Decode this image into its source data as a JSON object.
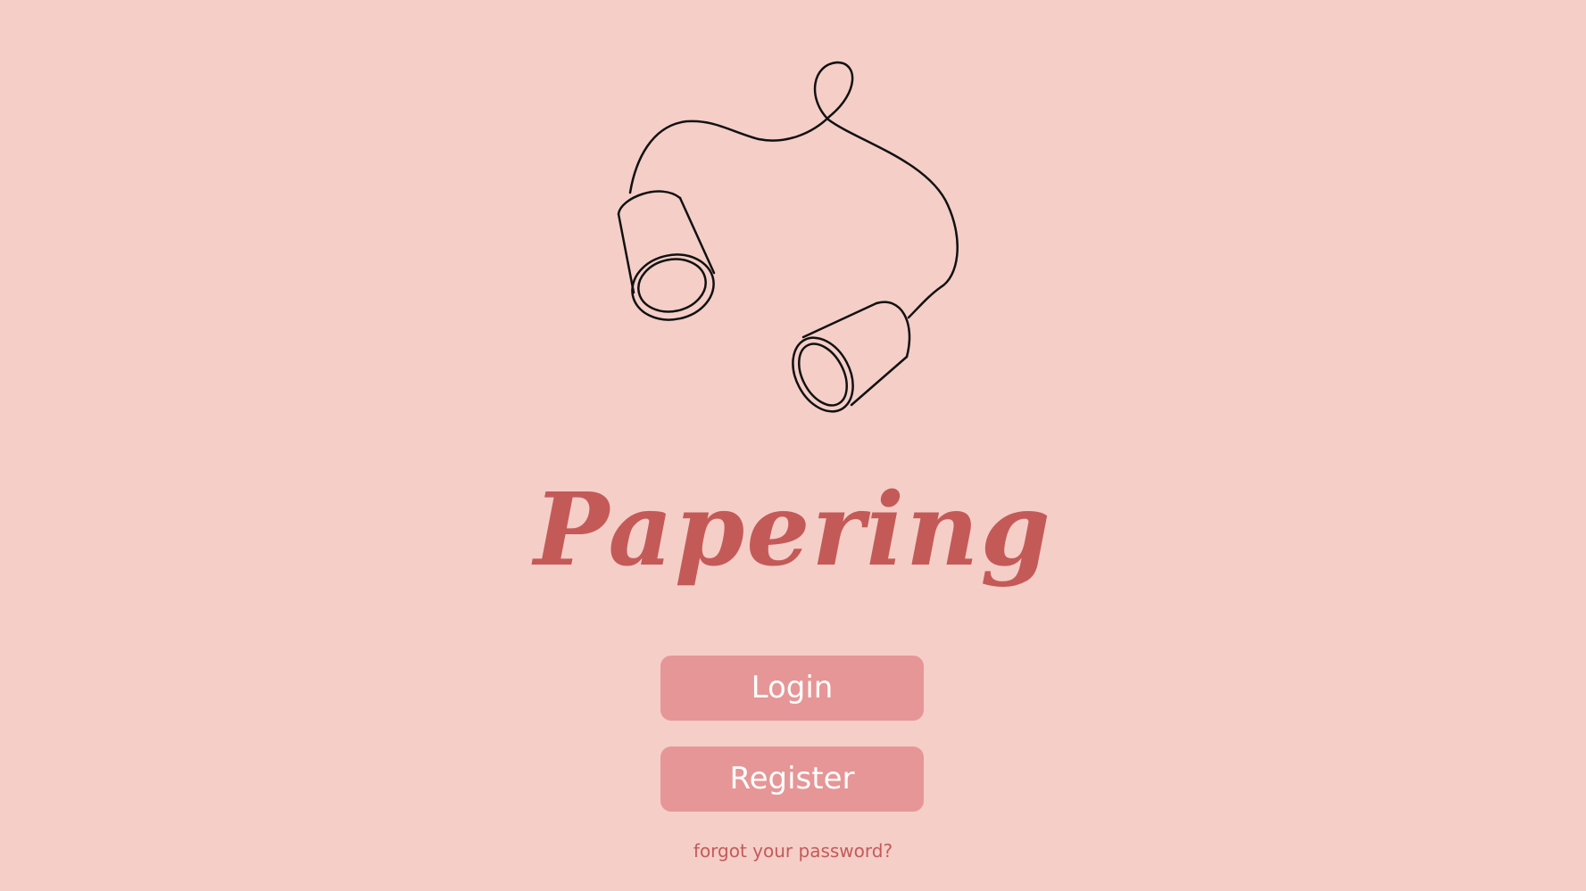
{
  "app": {
    "name": "Papering",
    "logo_icon": "tin-can-telephone-icon"
  },
  "actions": {
    "login_label": "Login",
    "register_label": "Register",
    "forgot_password_label": "forgot your password?"
  },
  "colors": {
    "background": "#f5cec8",
    "accent": "#c45a58",
    "button": "#e69696",
    "button_text": "#ffffff",
    "line_art": "#111111"
  }
}
